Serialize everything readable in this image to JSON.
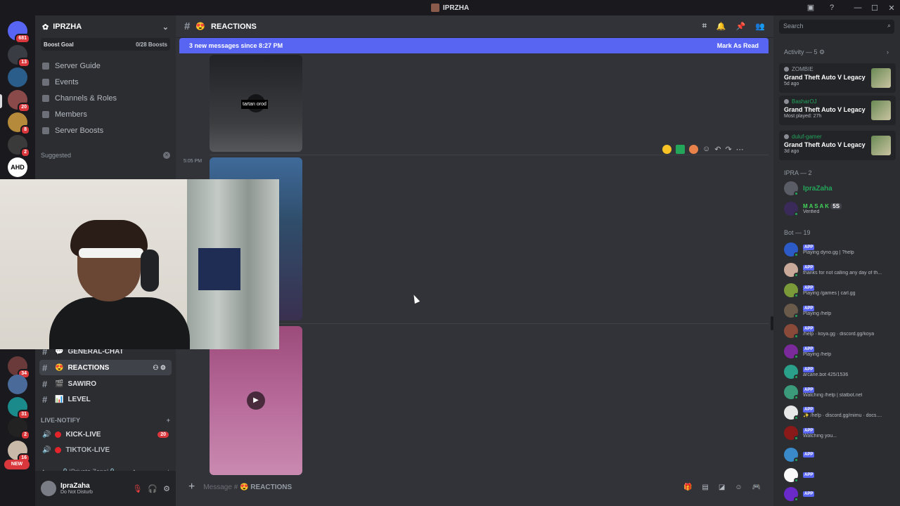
{
  "window": {
    "title": "IPRZHA",
    "controls": [
      "—",
      "☐",
      "✕"
    ]
  },
  "rail": {
    "badges": [
      "681",
      "13",
      "20",
      "8",
      "2",
      "34",
      "31",
      "2",
      "16"
    ],
    "new_label": "NEW",
    "ahd_label": "AHD"
  },
  "server": {
    "name": "IPRZHA",
    "boost_label": "Boost Goal",
    "boost_count": "0/28 Boosts"
  },
  "nav": [
    "Server Guide",
    "Events",
    "Channels & Roles",
    "Members",
    "Server Boosts"
  ],
  "suggested_label": "Suggested",
  "channels": [
    {
      "emoji": "💬",
      "name": "GENERAL-CHAT"
    },
    {
      "emoji": "😍",
      "name": "REACTIONS"
    },
    {
      "emoji": "🎬",
      "name": "SAWIRO"
    },
    {
      "emoji": "📊",
      "name": "LEVEL"
    }
  ],
  "live_notify": {
    "label": "LIVE-NOTIFY",
    "items": [
      {
        "name": "KICK-LIVE",
        "count": "20"
      },
      {
        "name": "TIKTOK-LIVE",
        "count": ""
      }
    ]
  },
  "private_zone": "✦⋯──🔒|Private Zone|🔒──⋯✦",
  "user": {
    "name": "IpraZaha",
    "status": "Do Not Disturb"
  },
  "main": {
    "channel": "REACTIONS",
    "new_messages": "3 new messages since 8:27 PM",
    "mark_read": "Mark As Read",
    "timestamp": "5:05 PM",
    "video_caption": "tartan orod",
    "composer_placeholder": "Message #",
    "composer_channel": "REACTIONS"
  },
  "members": {
    "search_placeholder": "Search",
    "activity_header": "Activity — 5",
    "activities": [
      {
        "user": "ZOMBIE",
        "game": "Grand Theft Auto V Legacy",
        "sub": "5d ago",
        "color": "#949ba4"
      },
      {
        "user": "BasharOJ",
        "game": "Grand Theft Auto V Legacy",
        "sub": "Most played: 27h",
        "color": "#23a55a"
      },
      {
        "user": "duluf-gamer",
        "game": "Grand Theft Auto V Legacy",
        "sub": "3d ago",
        "color": "#23a55a"
      }
    ],
    "ipra_header": "IPRA — 2",
    "ipra": [
      {
        "name": "IpraZaha",
        "sub": ""
      },
      {
        "name": "M A S A K",
        "sub": "Verified",
        "tag": "5S"
      }
    ],
    "bot_header": "Bot — 19",
    "app_label": "APP",
    "bots": [
      {
        "sub": "Playing dyno.gg | ?help"
      },
      {
        "sub": "thanks for not calling any day of th..."
      },
      {
        "sub": "Playing /games | carl.gg"
      },
      {
        "sub": "Playing /help"
      },
      {
        "sub": "/help · koya.gg · discord.gg/koya"
      },
      {
        "sub": "Playing /help"
      },
      {
        "sub": "arcane.bot 425/1536"
      },
      {
        "sub": "Watching /help | statbot.net"
      },
      {
        "sub": "✨ /help · discord.gg/mimu · docs...."
      },
      {
        "sub": "Watching you..."
      },
      {
        "sub": ""
      },
      {
        "sub": ""
      },
      {
        "sub": ""
      }
    ]
  }
}
